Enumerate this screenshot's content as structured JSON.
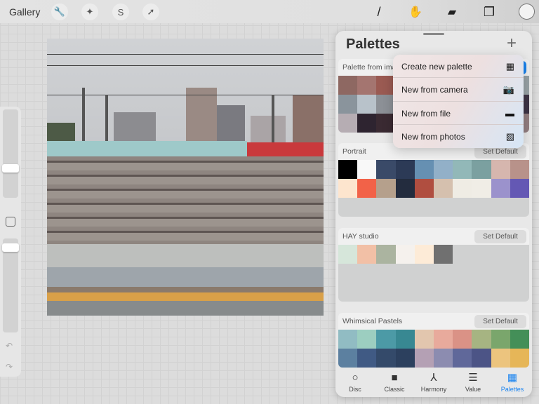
{
  "topbar": {
    "gallery": "Gallery",
    "left_tools": [
      {
        "icon": "wrench-icon",
        "glyph": "🔧"
      },
      {
        "icon": "magic-wand-icon",
        "glyph": "✦"
      },
      {
        "icon": "selection-icon",
        "glyph": "S"
      },
      {
        "icon": "transform-arrow-icon",
        "glyph": "➚"
      }
    ],
    "right_tools": [
      {
        "icon": "brush-icon",
        "glyph": "/"
      },
      {
        "icon": "smudge-icon",
        "glyph": "✋"
      },
      {
        "icon": "eraser-icon",
        "glyph": "▰"
      },
      {
        "icon": "layers-icon",
        "glyph": "❐"
      }
    ],
    "current_color": "#f3f3f3"
  },
  "panel": {
    "title": "Palettes",
    "add": "+",
    "palettes": [
      {
        "name": "Palette from image",
        "set_default": "",
        "colors": [
          "#8e6862",
          "#a47570",
          "#9a5a52",
          "#8d6a66",
          "#9a7672",
          "#a07c78",
          "#937570",
          "#8f7a78",
          "#947e7e",
          "#98a2a6",
          "#8a949c",
          "#b8c2ca",
          "#8c9096",
          "#a0a4aa",
          "#b0b4ba",
          "#7a7680",
          "#5a5060",
          "#4a4050",
          "#4a4052",
          "#3e3446",
          "#b6adb3",
          "#2e2430",
          "#3a2a32",
          "#4a3a40",
          "#5a4a50",
          "#6a5a60",
          "#7a6a70",
          "#8a7a78",
          "#8e7878",
          "#937e80"
        ]
      },
      {
        "name": "Portrait",
        "set_default": "Set Default",
        "colors": [
          "#000000",
          "#f8f8f8",
          "#3a4a68",
          "#2c3a56",
          "#6690b2",
          "#92b0c8",
          "#92b8b8",
          "#7ba0a0",
          "#d6b6ae",
          "#b8928a",
          "#fde5ce",
          "#f26248",
          "#b5a08c",
          "#232c3e",
          "#b04e40",
          "#d5c0ae",
          "#efece4",
          "#f0ede6",
          "#9b92cc",
          "#6458b4"
        ]
      },
      {
        "name": "HAY studio",
        "set_default": "Set Default",
        "colors": [
          "#d6e6da",
          "#f2c0a6",
          "#abb4a0",
          "#f5f1ed",
          "#fdebd7",
          "#707070"
        ]
      },
      {
        "name": "Whimsical Pastels",
        "set_default": "Set Default",
        "colors": [
          "#91bcc3",
          "#9ccec0",
          "#4c9aa6",
          "#388892",
          "#e2c6ae",
          "#e8aa9c",
          "#da9286",
          "#a6b482",
          "#7aa66c",
          "#448f58",
          "#5c80a0",
          "#405a84",
          "#344a6a",
          "#2c405e",
          "#b4a0b4",
          "#8c8cb0",
          "#60689a",
          "#4c5486",
          "#ecc47e",
          "#e6b658"
        ]
      }
    ],
    "menu": [
      {
        "label": "Create new palette",
        "icon": "grid-icon",
        "glyph": "▦"
      },
      {
        "label": "New from camera",
        "icon": "camera-icon",
        "glyph": "📷"
      },
      {
        "label": "New from file",
        "icon": "folder-icon",
        "glyph": "▬"
      },
      {
        "label": "New from photos",
        "icon": "photo-icon",
        "glyph": "▧"
      }
    ],
    "tabs": [
      {
        "label": "Disc",
        "icon": "disc-icon",
        "glyph": "○"
      },
      {
        "label": "Classic",
        "icon": "classic-square-icon",
        "glyph": "■"
      },
      {
        "label": "Harmony",
        "icon": "harmony-icon",
        "glyph": "⅄"
      },
      {
        "label": "Value",
        "icon": "value-icon",
        "glyph": "☰"
      },
      {
        "label": "Palettes",
        "icon": "palettes-grid-icon",
        "glyph": "▦",
        "active": true
      }
    ]
  },
  "accent": "#1a84f0"
}
